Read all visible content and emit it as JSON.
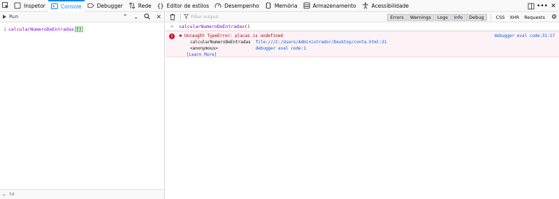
{
  "toolbar": {
    "tabs": [
      {
        "label": "Inspetor",
        "icon": "inspector-icon",
        "selected": false
      },
      {
        "label": "Console",
        "icon": "console-icon",
        "selected": true
      },
      {
        "label": "Debugger",
        "icon": "debugger-icon",
        "selected": false
      },
      {
        "label": "Rede",
        "icon": "network-icon",
        "selected": false
      },
      {
        "label": "Editor de estilos",
        "icon": "braces-icon",
        "selected": false
      },
      {
        "label": "Desempenho",
        "icon": "performance-icon",
        "selected": false
      },
      {
        "label": "Memória",
        "icon": "memory-icon",
        "selected": false
      },
      {
        "label": "Armazenamento",
        "icon": "storage-icon",
        "selected": false
      },
      {
        "label": "Acessibilidade",
        "icon": "accessibility-icon",
        "selected": false
      }
    ],
    "more_label": "•••",
    "close_label": "✕"
  },
  "editor": {
    "run_label": "Run",
    "lines": [
      {
        "number": "1",
        "code": "calcularNumeroDeEntradas",
        "paren": "()"
      }
    ],
    "footer_text": "54"
  },
  "console": {
    "filter_placeholder": "Filter output",
    "filter_buttons": [
      "Errors",
      "Warnings",
      "Logs",
      "Info",
      "Debug"
    ],
    "net_buttons": [
      "CSS",
      "XHR",
      "Requests"
    ],
    "command": {
      "name": "calcularNumeroDeEntradas",
      "paren": "()"
    },
    "error": {
      "message": "Uncaught TypeError: placas is undefined",
      "location": "debugger eval code:31:17",
      "trace": [
        {
          "fn": "calcularNumeroDeEntradas",
          "src": "file:///C:/Users/Administrador/Desktop/conta.html:31"
        },
        {
          "fn": "<anonymous>",
          "src": "debugger eval code:1"
        }
      ],
      "learn_more": "[Learn More]"
    }
  },
  "colors": {
    "accent": "#0a84ff",
    "error_text": "#a4000f",
    "error_bg": "#fdf2f5",
    "link": "#0060df",
    "code": "#8000d7"
  }
}
